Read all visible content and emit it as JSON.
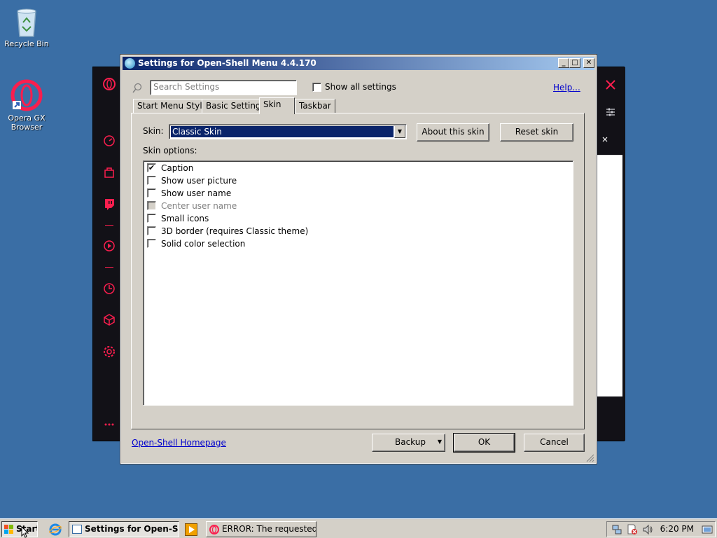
{
  "desktop": {
    "icons": [
      {
        "label": "Recycle Bin",
        "icon": "recycle-bin-icon"
      },
      {
        "label": "Opera GX\nBrowser",
        "icon": "opera-gx-icon"
      }
    ]
  },
  "dialog": {
    "title": "Settings for Open-Shell Menu 4.4.170",
    "search_placeholder": "Search Settings",
    "show_all_label": "Show all settings",
    "show_all_checked": false,
    "help_link": "Help...",
    "tabs": [
      {
        "label": "Start Menu Style",
        "active": false
      },
      {
        "label": "Basic Settings",
        "active": false
      },
      {
        "label": "Skin",
        "active": true
      },
      {
        "label": "Taskbar",
        "active": false
      }
    ],
    "skin_label": "Skin:",
    "skin_value": "Classic Skin",
    "about_skin_button": "About this skin",
    "reset_skin_button": "Reset skin",
    "skin_options_label": "Skin options:",
    "options": [
      {
        "label": "Caption",
        "checked": true,
        "enabled": true
      },
      {
        "label": "Show user picture",
        "checked": false,
        "enabled": true
      },
      {
        "label": "Show user name",
        "checked": false,
        "enabled": true
      },
      {
        "label": "Center user name",
        "checked": false,
        "enabled": false
      },
      {
        "label": "Small icons",
        "checked": false,
        "enabled": true
      },
      {
        "label": "3D border (requires Classic theme)",
        "checked": false,
        "enabled": true
      },
      {
        "label": "Solid color selection",
        "checked": false,
        "enabled": true
      }
    ],
    "homepage_link": "Open-Shell Homepage",
    "backup_button": "Backup",
    "ok_button": "OK",
    "cancel_button": "Cancel"
  },
  "taskbar": {
    "start_label": "Start",
    "windows": [
      {
        "label": "Settings for Open-Sh...",
        "active": true
      },
      {
        "label": "ERROR: The requested ...",
        "active": false
      }
    ],
    "clock": "6:20 PM"
  },
  "colors": {
    "desktop": "#3a6ea5",
    "opera_accent": "#fa1e4e",
    "selection": "#0a246a"
  }
}
